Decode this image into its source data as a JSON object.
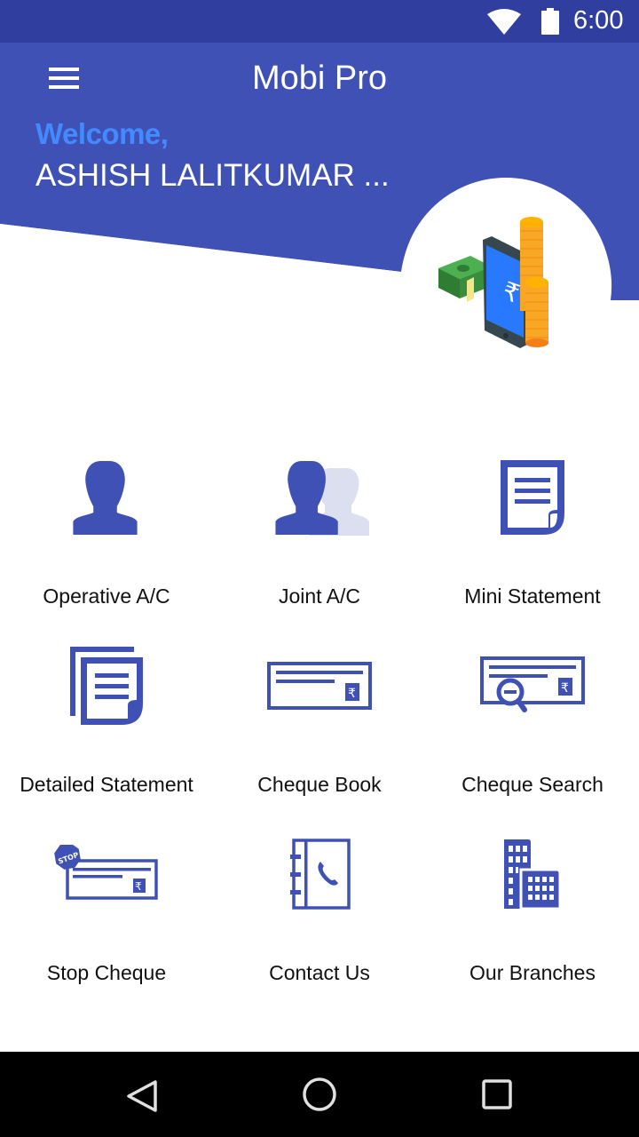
{
  "status_bar": {
    "time": "6:00",
    "icons": [
      "wifi-icon",
      "battery-icon"
    ]
  },
  "app_bar": {
    "title": "Mobi Pro",
    "menu_icon": "hamburger-menu-icon"
  },
  "hero": {
    "welcome": "Welcome,",
    "username": "ASHISH LALITKUMAR ...",
    "illustration": "money-phone-coins-illustration"
  },
  "menu_grid": {
    "items": [
      {
        "label": "Operative A/C",
        "icon": "person-icon"
      },
      {
        "label": "Joint A/C",
        "icon": "two-persons-icon"
      },
      {
        "label": "Mini Statement",
        "icon": "document-icon"
      },
      {
        "label": "Detailed Statement",
        "icon": "stacked-documents-icon"
      },
      {
        "label": "Cheque Book",
        "icon": "cheque-icon"
      },
      {
        "label": "Cheque Search",
        "icon": "cheque-search-icon"
      },
      {
        "label": "Stop Cheque",
        "icon": "stop-cheque-icon"
      },
      {
        "label": "Contact Us",
        "icon": "phone-book-icon"
      },
      {
        "label": "Our Branches",
        "icon": "buildings-icon"
      }
    ]
  },
  "nav_bar": {
    "back": "back-icon",
    "home": "home-icon",
    "recents": "recents-icon"
  },
  "colors": {
    "status_bar": "#303f9f",
    "primary": "#3f51b5",
    "accent": "#448aff",
    "icon_blue": "#3f51b5"
  }
}
